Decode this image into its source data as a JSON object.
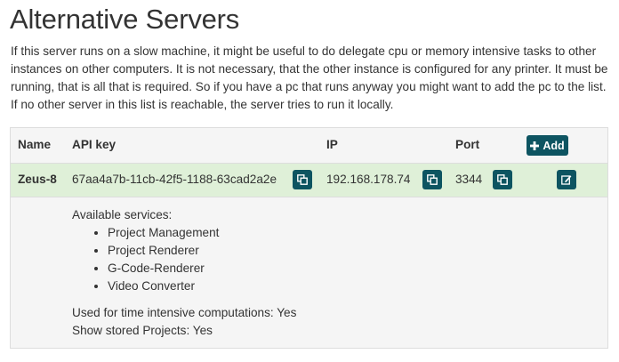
{
  "page": {
    "title": "Alternative Servers",
    "description": "If this server runs on a slow machine, it might be useful to do delegate cpu or memory intensive tasks to other instances on other computers. It is not necessary, that the other instance is configured for any printer. It must be running, that is all that is required. So if you have a pc that runs anyway you might want to add the pc to the list. If no other server in this list is reachable, the server tries to run it locally."
  },
  "table": {
    "headers": {
      "name": "Name",
      "api_key": "API key",
      "ip": "IP",
      "port": "Port"
    },
    "add_button_label": "Add",
    "add_button_icon": "plus-icon",
    "rows": [
      {
        "name": "Zeus-8",
        "api_key": "67aa4a7b-11cb-42f5-1188-63cad2a2e",
        "ip": "192.168.178.74",
        "port": "3344",
        "copy_icon": "copy-icon",
        "edit_icon": "edit-icon",
        "details": {
          "services_label": "Available services:",
          "services": [
            "Project Management",
            "Project Renderer",
            "G-Code-Renderer",
            "Video Converter"
          ],
          "time_intensive": "Used for time intensive computations: Yes",
          "show_projects": "Show stored Projects: Yes"
        }
      }
    ]
  },
  "colors": {
    "accent": "#0d5461",
    "row_success": "#dff0d8",
    "panel_bg": "#f5f5f5",
    "border": "#dddddd"
  }
}
